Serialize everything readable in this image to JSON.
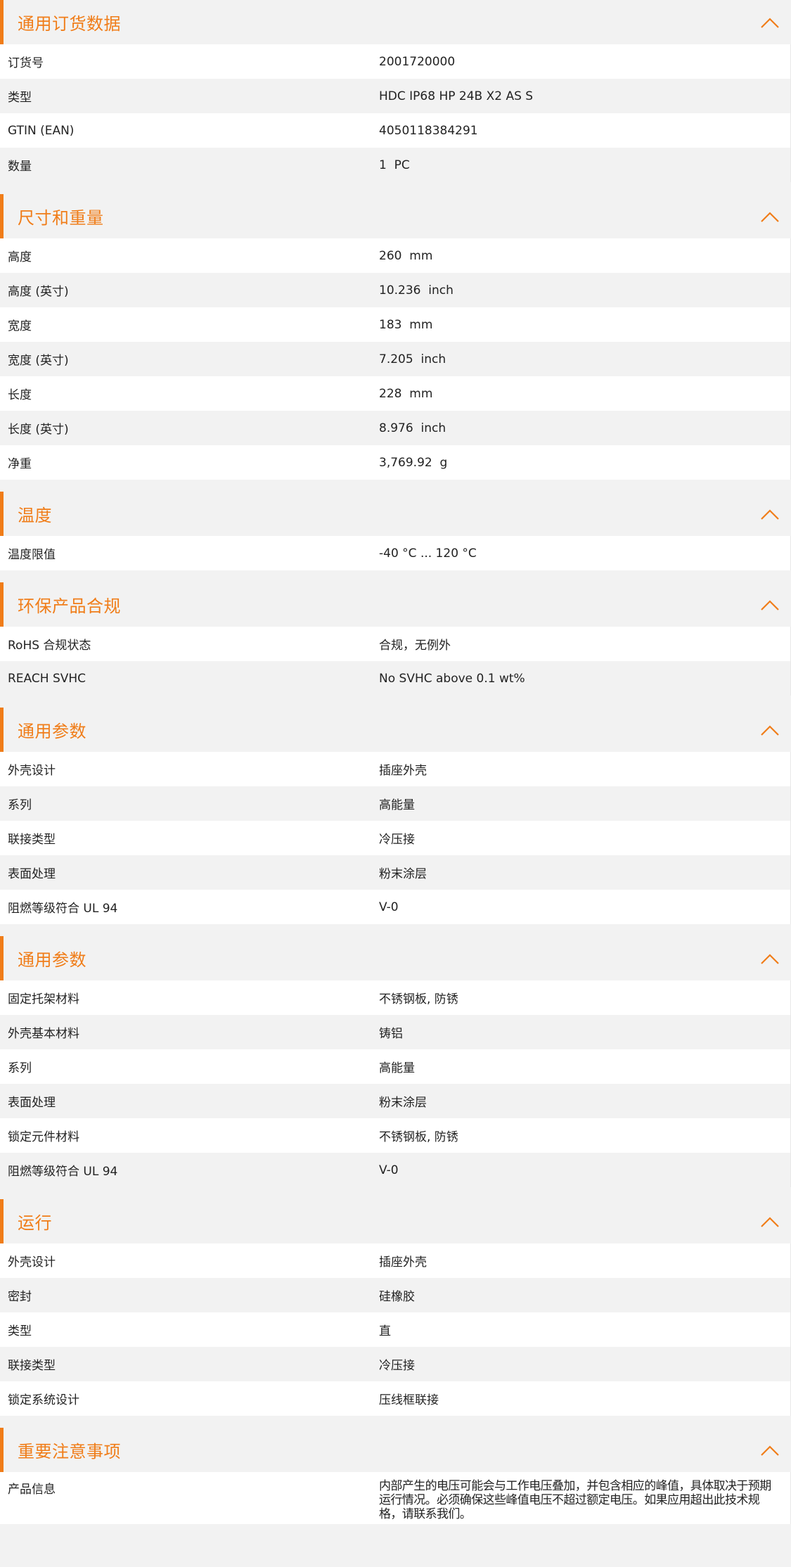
{
  "sections": [
    {
      "title": "通用订货数据",
      "rows": [
        {
          "label": "订货号",
          "value": "2001720000"
        },
        {
          "label": "类型",
          "value": "HDC IP68 HP 24B X2 AS S"
        },
        {
          "label": "GTIN (EAN)",
          "value": "4050118384291"
        },
        {
          "label": "数量",
          "value": "1  PC"
        }
      ]
    },
    {
      "title": "尺寸和重量",
      "rows": [
        {
          "label": "高度",
          "value": "260  mm"
        },
        {
          "label": "高度 (英寸)",
          "value": "10.236  inch"
        },
        {
          "label": "宽度",
          "value": "183  mm"
        },
        {
          "label": "宽度 (英寸)",
          "value": "7.205  inch"
        },
        {
          "label": "长度",
          "value": "228  mm"
        },
        {
          "label": "长度 (英寸)",
          "value": "8.976  inch"
        },
        {
          "label": "净重",
          "value": "3,769.92  g"
        }
      ]
    },
    {
      "title": "温度",
      "rows": [
        {
          "label": "温度限值",
          "value": "-40 °C ... 120 °C"
        }
      ]
    },
    {
      "title": "环保产品合规",
      "rows": [
        {
          "label": "RoHS 合规状态",
          "value": "合规，无例外"
        },
        {
          "label": "REACH SVHC",
          "value": "No SVHC above 0.1 wt%"
        }
      ]
    },
    {
      "title": "通用参数",
      "rows": [
        {
          "label": "外壳设计",
          "value": "插座外壳"
        },
        {
          "label": "系列",
          "value": "高能量"
        },
        {
          "label": "联接类型",
          "value": "冷压接"
        },
        {
          "label": "表面处理",
          "value": "粉末涂层"
        },
        {
          "label": "阻燃等级符合 UL 94",
          "value": "V-0"
        }
      ]
    },
    {
      "title": "通用参数",
      "rows": [
        {
          "label": "固定托架材料",
          "value": "不锈钢板, 防锈"
        },
        {
          "label": "外壳基本材料",
          "value": "铸铝"
        },
        {
          "label": "系列",
          "value": "高能量"
        },
        {
          "label": "表面处理",
          "value": "粉末涂层"
        },
        {
          "label": "锁定元件材料",
          "value": "不锈钢板, 防锈"
        },
        {
          "label": "阻燃等级符合 UL 94",
          "value": "V-0"
        }
      ]
    },
    {
      "title": "运行",
      "rows": [
        {
          "label": "外壳设计",
          "value": "插座外壳"
        },
        {
          "label": "密封",
          "value": "硅橡胶"
        },
        {
          "label": "类型",
          "value": "直"
        },
        {
          "label": "联接类型",
          "value": "冷压接"
        },
        {
          "label": "锁定系统设计",
          "value": "压线框联接"
        }
      ]
    },
    {
      "title": "重要注意事项",
      "rows": [
        {
          "label": "产品信息",
          "value": "内部产生的电压可能会与工作电压叠加，并包含相应的峰值，具体取决于预期运行情况。必须确保这些峰值电压不超过额定电压。如果应用超出此技术规格，请联系我们。",
          "multi": true
        }
      ]
    }
  ],
  "colors": {
    "accent": "#f07d19",
    "header_bg": "#f2f2f2",
    "row_alt": "#f2f2f2"
  },
  "icons": {
    "section_toggle": "chevron-up-icon"
  }
}
